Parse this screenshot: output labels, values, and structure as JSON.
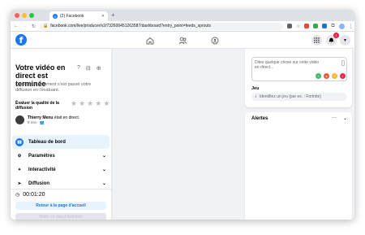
{
  "browser": {
    "tab_title": "(2) Facebook",
    "tab_close": "✕",
    "new_tab": "+",
    "url": "facebook.com/live/producer/v2/732600451263587/dashboard?entry_point=feeds_sprouts",
    "traffic_colors": [
      "#ff5f57",
      "#febc2e",
      "#28c840"
    ]
  },
  "header": {
    "logo": "f",
    "notification_count": "2"
  },
  "left_panel": {
    "title": "Votre vidéo en direct est terminée",
    "description": "Dites-nous comment s'est passé votre diffusion en l'évaluant.",
    "rating_label": "Évaluer la qualité de la diffusion",
    "stars": [
      "★",
      "★",
      "★",
      "★",
      "★"
    ],
    "user_name": "Thierry Menu",
    "user_status": " était en direct.",
    "user_time": "8 min · ",
    "menu": [
      {
        "label": "Tableau de bord",
        "icon": "dashboard-icon",
        "active": true
      },
      {
        "label": "Paramètres",
        "icon": "gear-icon",
        "active": false
      },
      {
        "label": "Interactivité",
        "icon": "interactivity-icon",
        "active": false
      },
      {
        "label": "Diffusion",
        "icon": "broadcast-icon",
        "active": false
      }
    ],
    "timer": "00:01:20",
    "back_button": "Retour à la page d'accueil",
    "end_button": "Vidéo en direct terminée"
  },
  "right_panel": {
    "post_placeholder": "Dites quelque chose sur cette vidéo en direct...",
    "game_label": "Jeu",
    "game_placeholder": "Identifiez un jeu (par ex. : Fortnite)",
    "alerts_title": "Alertes",
    "alerts_more": "···",
    "alerts_toggle": "⌄"
  },
  "colors": {
    "brand": "#1877f2",
    "active_bg": "#e7f3ff",
    "badge": "#e41e3f"
  }
}
